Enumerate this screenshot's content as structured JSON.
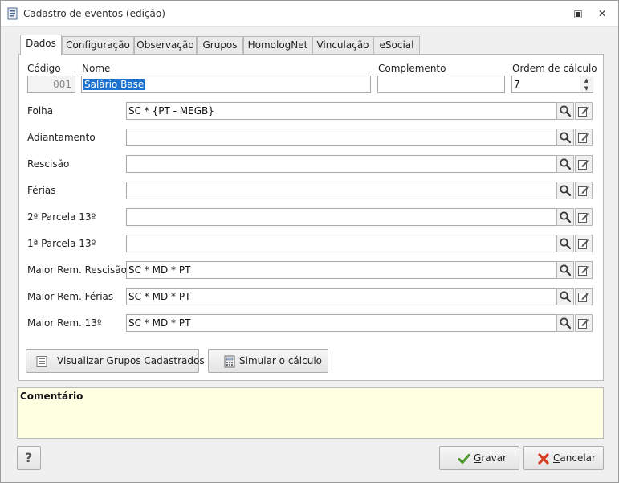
{
  "window": {
    "title": "Cadastro de eventos (edição)",
    "restore_glyph": "▣",
    "close_glyph": "✕"
  },
  "tabs": [
    "Dados",
    "Configuração",
    "Observação",
    "Grupos",
    "HomologNet",
    "Vinculação",
    "eSocial"
  ],
  "header_fields": {
    "codigo_label": "Código",
    "codigo_value": "001",
    "nome_label": "Nome",
    "nome_value": "Salário Base",
    "complemento_label": "Complemento",
    "complemento_value": "",
    "ordem_label": "Ordem de cálculo",
    "ordem_value": "7"
  },
  "formulas": [
    {
      "label": "Folha",
      "value": "SC * {PT - MEGB}"
    },
    {
      "label": "Adiantamento",
      "value": ""
    },
    {
      "label": "Rescisão",
      "value": ""
    },
    {
      "label": "Férias",
      "value": ""
    },
    {
      "label": "2ª Parcela 13º",
      "value": ""
    },
    {
      "label": "1ª Parcela 13º",
      "value": ""
    },
    {
      "label": "Maior Rem. Rescisão",
      "value": "SC * MD * PT"
    },
    {
      "label": "Maior Rem. Férias",
      "value": "SC * MD * PT"
    },
    {
      "label": "Maior Rem. 13º",
      "value": "SC * MD * PT"
    }
  ],
  "panel_buttons": {
    "visualizar": "Visualizar Grupos Cadastrados",
    "simular": "Simular o cálculo"
  },
  "comment": {
    "label": "Comentário",
    "value": ""
  },
  "footer": {
    "help": "?",
    "gravar_accel": "G",
    "gravar_rest": "ravar",
    "cancelar_accel": "C",
    "cancelar_rest": "ancelar"
  },
  "icons": {
    "search": "magnifier-icon",
    "edit": "edit-pencil-icon",
    "gravar": "checkmark-icon",
    "cancelar": "red-x-icon"
  },
  "colors": {
    "selection": "#1e72cf",
    "comment_bg": "#ffffe1",
    "check_green": "#4a9a2a",
    "cancel_red": "#d43c1f"
  }
}
